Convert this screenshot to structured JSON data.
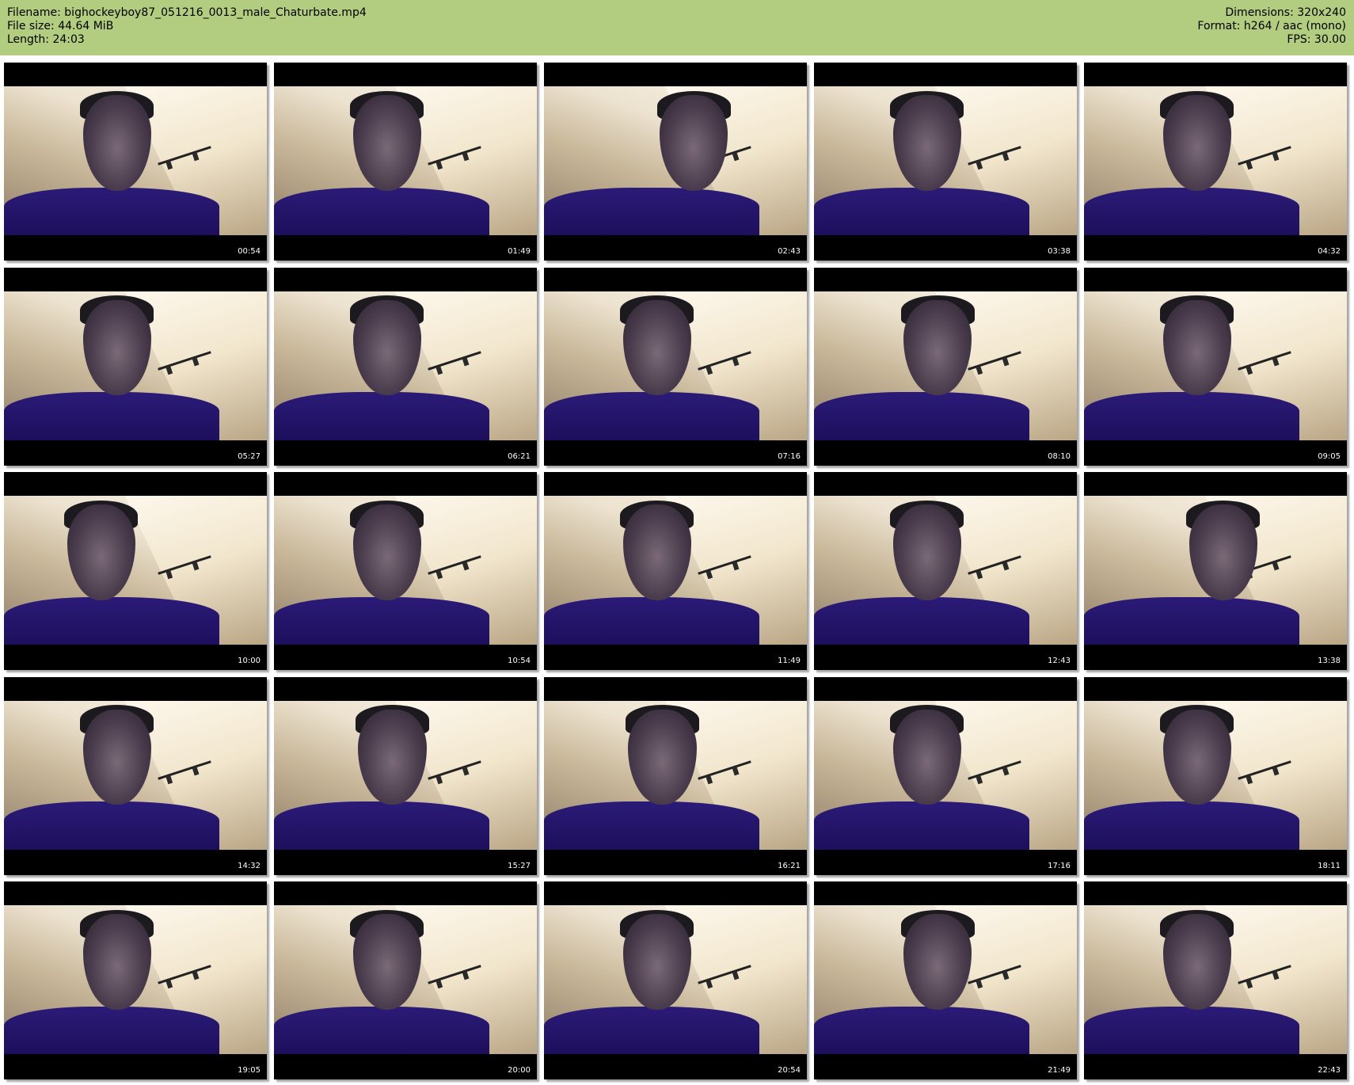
{
  "header": {
    "filename": "Filename: bighockeyboy87_051216_0013_male_Chaturbate.mp4",
    "filesize": "File size: 44.64 MiB",
    "length": "Length: 24:03",
    "dimensions": "Dimensions: 320x240",
    "format": "Format: h264 / aac (mono)",
    "fps": "FPS: 30.00",
    "background_color": "#b2cc80"
  },
  "thumbnails": [
    {
      "timestamp": "00:54"
    },
    {
      "timestamp": "01:49"
    },
    {
      "timestamp": "02:43"
    },
    {
      "timestamp": "03:38"
    },
    {
      "timestamp": "04:32"
    },
    {
      "timestamp": "05:27"
    },
    {
      "timestamp": "06:21"
    },
    {
      "timestamp": "07:16"
    },
    {
      "timestamp": "08:10"
    },
    {
      "timestamp": "09:05"
    },
    {
      "timestamp": "10:00"
    },
    {
      "timestamp": "10:54"
    },
    {
      "timestamp": "11:49"
    },
    {
      "timestamp": "12:43"
    },
    {
      "timestamp": "13:38"
    },
    {
      "timestamp": "14:32"
    },
    {
      "timestamp": "15:27"
    },
    {
      "timestamp": "16:21"
    },
    {
      "timestamp": "17:16"
    },
    {
      "timestamp": "18:11"
    },
    {
      "timestamp": "19:05"
    },
    {
      "timestamp": "20:00"
    },
    {
      "timestamp": "20:54"
    },
    {
      "timestamp": "21:49"
    },
    {
      "timestamp": "22:43"
    }
  ]
}
